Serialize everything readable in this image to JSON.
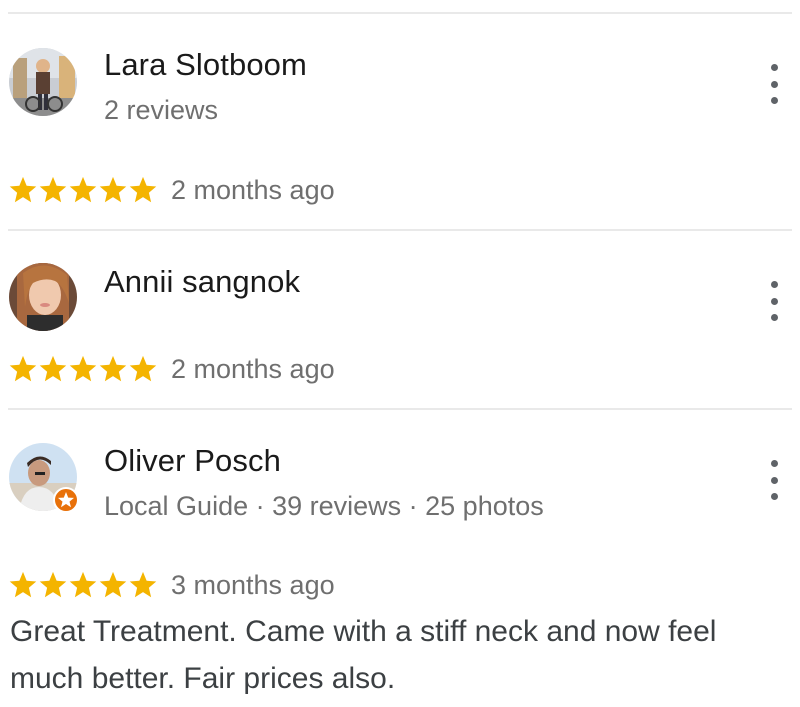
{
  "colors": {
    "star": "#f4b400",
    "meta": "#6f6f6f",
    "divider": "#e9e9e9",
    "badge": "#e8710a"
  },
  "reviews": [
    {
      "author": "Lara Slotboom",
      "meta": "2 reviews",
      "rating": 5,
      "time": "2 months ago",
      "text": ""
    },
    {
      "author": "Annii sangnok",
      "meta": "",
      "rating": 5,
      "time": "2 months ago",
      "text": ""
    },
    {
      "author": "Oliver Posch",
      "meta": "Local Guide · 39 reviews · 25 photos",
      "local_guide": true,
      "rating": 5,
      "time": "3 months ago",
      "text": "Great Treatment. Came with a stiff neck and now feel much better. Fair prices also."
    }
  ],
  "icons": {
    "more": "more-vert-icon",
    "star": "star-icon",
    "badge": "local-guide-badge-icon"
  }
}
